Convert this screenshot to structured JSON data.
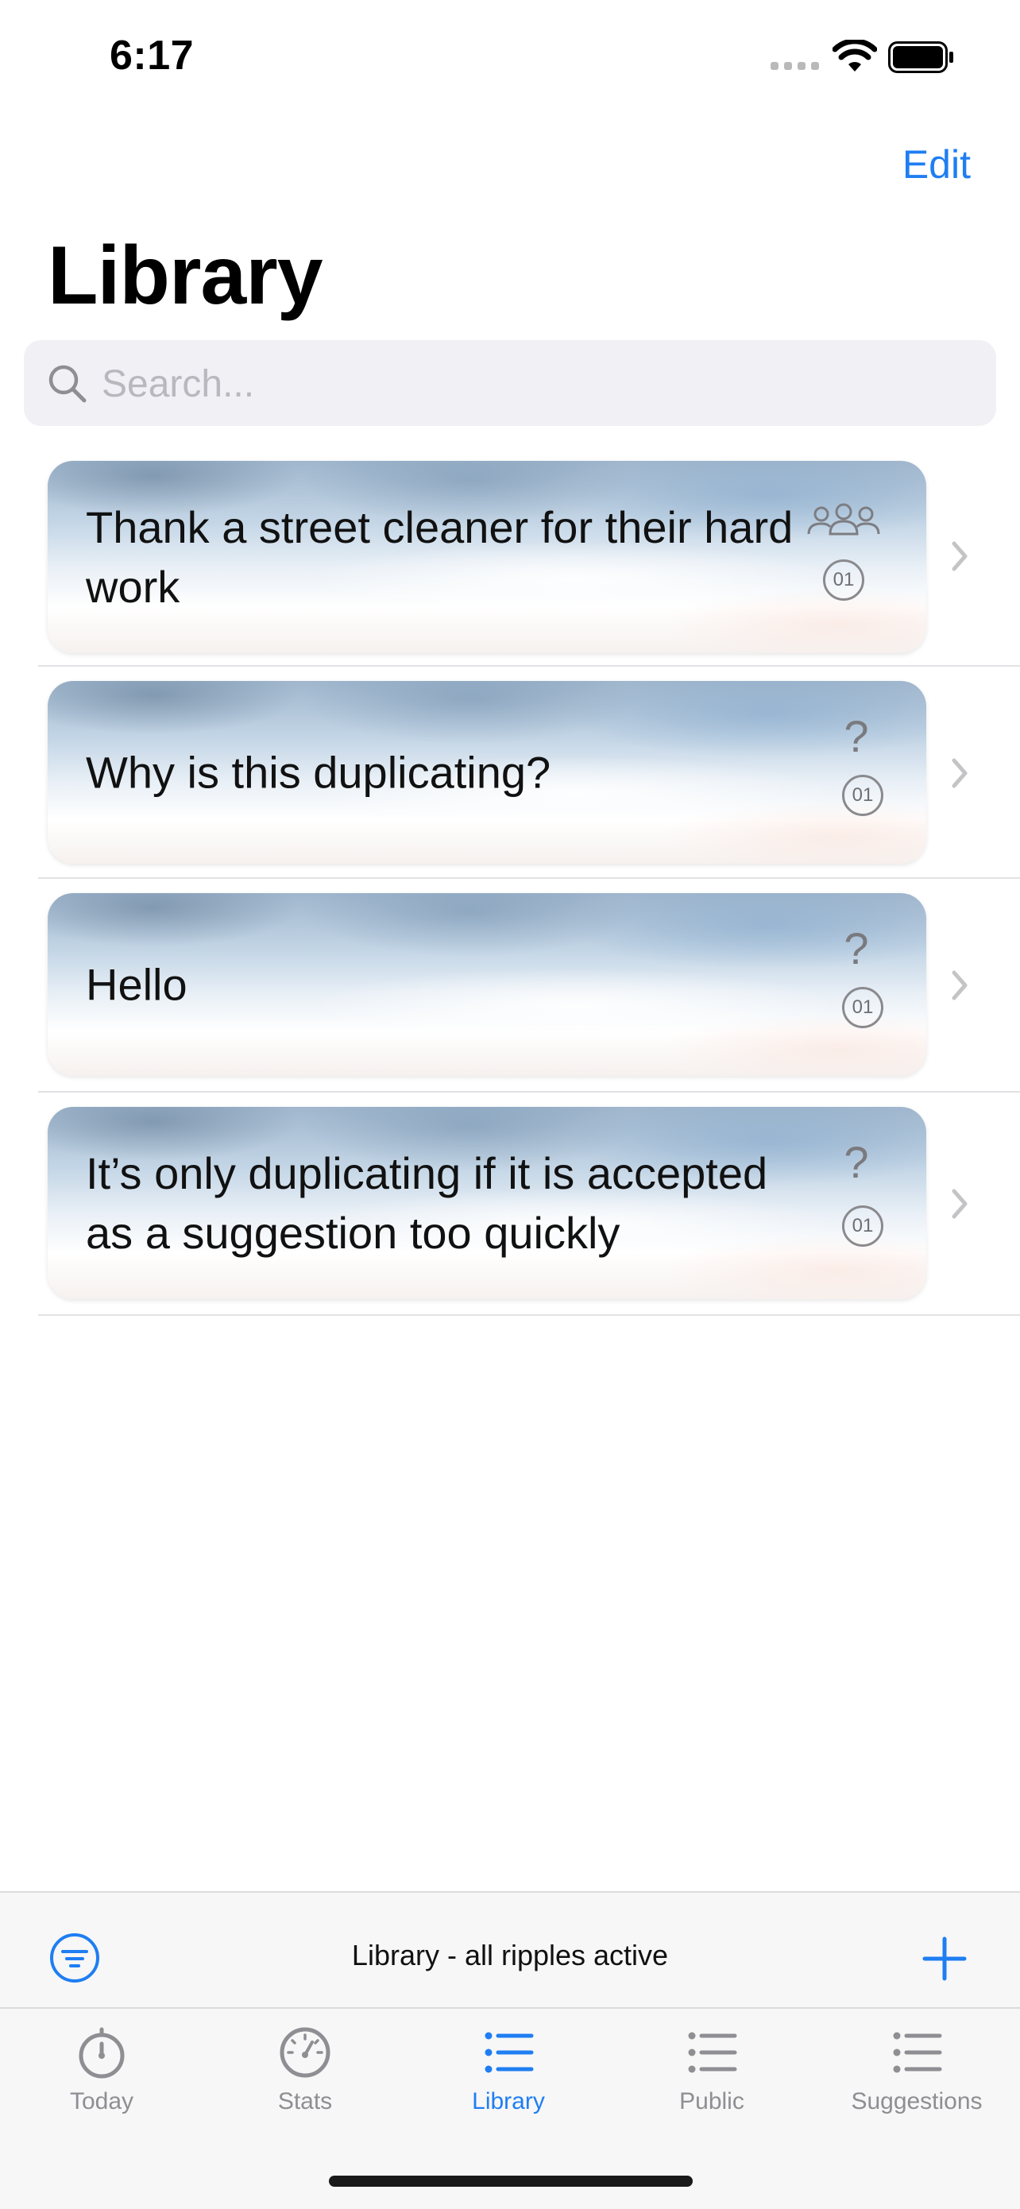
{
  "status_bar": {
    "time": "6:17"
  },
  "nav": {
    "edit_label": "Edit",
    "title": "Library"
  },
  "search": {
    "placeholder": "Search..."
  },
  "items": [
    {
      "text": "Thank a street cleaner for their hard work",
      "type_icon": "group-icon",
      "count": "01"
    },
    {
      "text": "Why is this duplicating?",
      "type_icon": "question-icon",
      "type_glyph": "?",
      "count": "01"
    },
    {
      "text": "Hello",
      "type_icon": "question-icon",
      "type_glyph": "?",
      "count": "01"
    },
    {
      "text": "It’s only duplicating if it is accepted as a suggestion too quickly",
      "type_icon": "question-icon",
      "type_glyph": "?",
      "count": "01"
    }
  ],
  "toolbar": {
    "status_text": "Library - all ripples active",
    "filter_icon": "filter-icon",
    "add_icon": "plus-icon"
  },
  "tabs": [
    {
      "label": "Today",
      "icon": "stopwatch-icon"
    },
    {
      "label": "Stats",
      "icon": "gauge-icon"
    },
    {
      "label": "Library",
      "icon": "list-icon",
      "active": true
    },
    {
      "label": "Public",
      "icon": "list-icon"
    },
    {
      "label": "Suggestions",
      "icon": "list-icon"
    }
  ],
  "colors": {
    "accent": "#1f7ef2",
    "inactive": "#8e8e93",
    "background": "#ffffff",
    "search_bg": "#f0f0f5"
  }
}
